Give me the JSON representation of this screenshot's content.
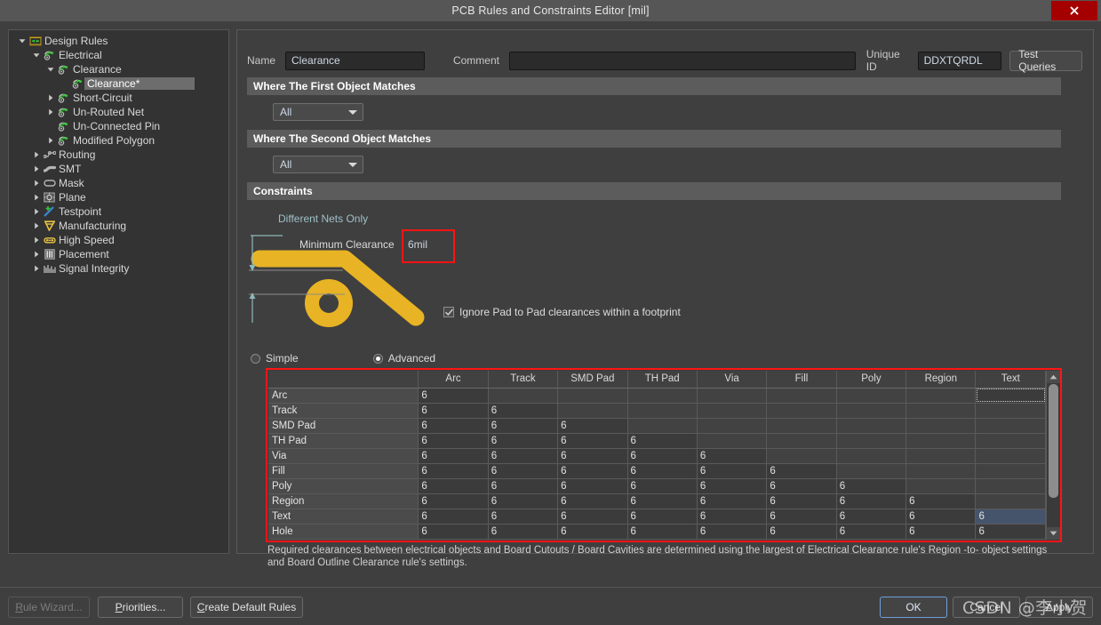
{
  "window": {
    "title": "PCB Rules and Constraints Editor [mil]",
    "close_icon": "close-icon",
    "close_color": "#a50000"
  },
  "tree": {
    "items": [
      {
        "label": "Design Rules",
        "depth": 0,
        "arrow": "down",
        "icon": "design-rules-folder-icon",
        "selected": false
      },
      {
        "label": "Electrical",
        "depth": 1,
        "arrow": "down",
        "icon": "electrical-rule-icon",
        "selected": false
      },
      {
        "label": "Clearance",
        "depth": 2,
        "arrow": "down",
        "icon": "electrical-rule-icon",
        "selected": false
      },
      {
        "label": "Clearance*",
        "depth": 3,
        "arrow": "none",
        "icon": "electrical-rule-icon",
        "selected": true
      },
      {
        "label": "Short-Circuit",
        "depth": 2,
        "arrow": "right",
        "icon": "electrical-rule-icon",
        "selected": false
      },
      {
        "label": "Un-Routed Net",
        "depth": 2,
        "arrow": "right",
        "icon": "electrical-rule-icon",
        "selected": false
      },
      {
        "label": "Un-Connected Pin",
        "depth": 2,
        "arrow": "none",
        "icon": "electrical-rule-icon",
        "selected": false
      },
      {
        "label": "Modified Polygon",
        "depth": 2,
        "arrow": "right",
        "icon": "electrical-rule-icon",
        "selected": false
      },
      {
        "label": "Routing",
        "depth": 1,
        "arrow": "right",
        "icon": "routing-icon",
        "selected": false
      },
      {
        "label": "SMT",
        "depth": 1,
        "arrow": "right",
        "icon": "smt-icon",
        "selected": false
      },
      {
        "label": "Mask",
        "depth": 1,
        "arrow": "right",
        "icon": "mask-icon",
        "selected": false
      },
      {
        "label": "Plane",
        "depth": 1,
        "arrow": "right",
        "icon": "plane-icon",
        "selected": false
      },
      {
        "label": "Testpoint",
        "depth": 1,
        "arrow": "right",
        "icon": "testpoint-icon",
        "selected": false
      },
      {
        "label": "Manufacturing",
        "depth": 1,
        "arrow": "right",
        "icon": "manufacturing-icon",
        "selected": false
      },
      {
        "label": "High Speed",
        "depth": 1,
        "arrow": "right",
        "icon": "high-speed-icon",
        "selected": false
      },
      {
        "label": "Placement",
        "depth": 1,
        "arrow": "right",
        "icon": "placement-icon",
        "selected": false
      },
      {
        "label": "Signal Integrity",
        "depth": 1,
        "arrow": "right",
        "icon": "signal-integrity-icon",
        "selected": false
      }
    ]
  },
  "form": {
    "name_label": "Name",
    "name_value": "Clearance",
    "comment_label": "Comment",
    "comment_value": "",
    "comment_placeholder": "",
    "unique_id_label": "Unique ID",
    "unique_id_value": "DDXTQRDL",
    "test_queries_label": "Test Queries"
  },
  "first_object": {
    "section_title": "Where The First Object Matches",
    "selected": "All"
  },
  "second_object": {
    "section_title": "Where The Second Object Matches",
    "selected": "All"
  },
  "constraints": {
    "section_title": "Constraints",
    "different_nets_only": "Different Nets Only",
    "minimum_clearance_label": "Minimum Clearance",
    "minimum_clearance_value": "6mil",
    "highlight_color": "#ff1414",
    "ignore_pad_label": "Ignore Pad to Pad clearances within a footprint",
    "ignore_pad_checked": true,
    "mode_simple": "Simple",
    "mode_advanced": "Advanced",
    "mode_selected": "Advanced",
    "track_color": "#e8b324",
    "dim_color": "#8fb9b9"
  },
  "grid": {
    "corner_label": "",
    "columns": [
      "Arc",
      "Track",
      "SMD Pad",
      "TH Pad",
      "Via",
      "Fill",
      "Poly",
      "Region",
      "Text"
    ],
    "rows": [
      {
        "label": "Arc",
        "values": [
          "6",
          "",
          "",
          "",
          "",
          "",
          "",
          "",
          ""
        ]
      },
      {
        "label": "Track",
        "values": [
          "6",
          "6",
          "",
          "",
          "",
          "",
          "",
          "",
          ""
        ]
      },
      {
        "label": "SMD Pad",
        "values": [
          "6",
          "6",
          "6",
          "",
          "",
          "",
          "",
          "",
          ""
        ]
      },
      {
        "label": "TH Pad",
        "values": [
          "6",
          "6",
          "6",
          "6",
          "",
          "",
          "",
          "",
          ""
        ]
      },
      {
        "label": "Via",
        "values": [
          "6",
          "6",
          "6",
          "6",
          "6",
          "",
          "",
          "",
          ""
        ]
      },
      {
        "label": "Fill",
        "values": [
          "6",
          "6",
          "6",
          "6",
          "6",
          "6",
          "",
          "",
          ""
        ]
      },
      {
        "label": "Poly",
        "values": [
          "6",
          "6",
          "6",
          "6",
          "6",
          "6",
          "6",
          "",
          ""
        ]
      },
      {
        "label": "Region",
        "values": [
          "6",
          "6",
          "6",
          "6",
          "6",
          "6",
          "6",
          "6",
          ""
        ]
      },
      {
        "label": "Text",
        "values": [
          "6",
          "6",
          "6",
          "6",
          "6",
          "6",
          "6",
          "6",
          "6"
        ]
      },
      {
        "label": "Hole",
        "values": [
          "6",
          "6",
          "6",
          "6",
          "6",
          "6",
          "6",
          "6",
          "6"
        ]
      }
    ],
    "focus_cell": {
      "row": 0,
      "col": 8
    },
    "selected_cell": {
      "row": 8,
      "col": 8
    },
    "scroll_up_icon": "chevron-up-icon",
    "scroll_down_icon": "chevron-down-icon"
  },
  "help_text": "Required clearances between electrical objects and Board Cutouts / Board Cavities are determined using the largest of Electrical Clearance rule's Region -to- object settings and Board Outline Clearance rule's settings.",
  "footer": {
    "rule_wizard": "Rule Wizard...",
    "rule_wizard_disabled": true,
    "priorities": "Priorities...",
    "create_default_rules": "Create Default Rules",
    "ok": "OK",
    "cancel": "Cancel",
    "apply": "Apply"
  },
  "watermark": "CSDN @李小贺"
}
